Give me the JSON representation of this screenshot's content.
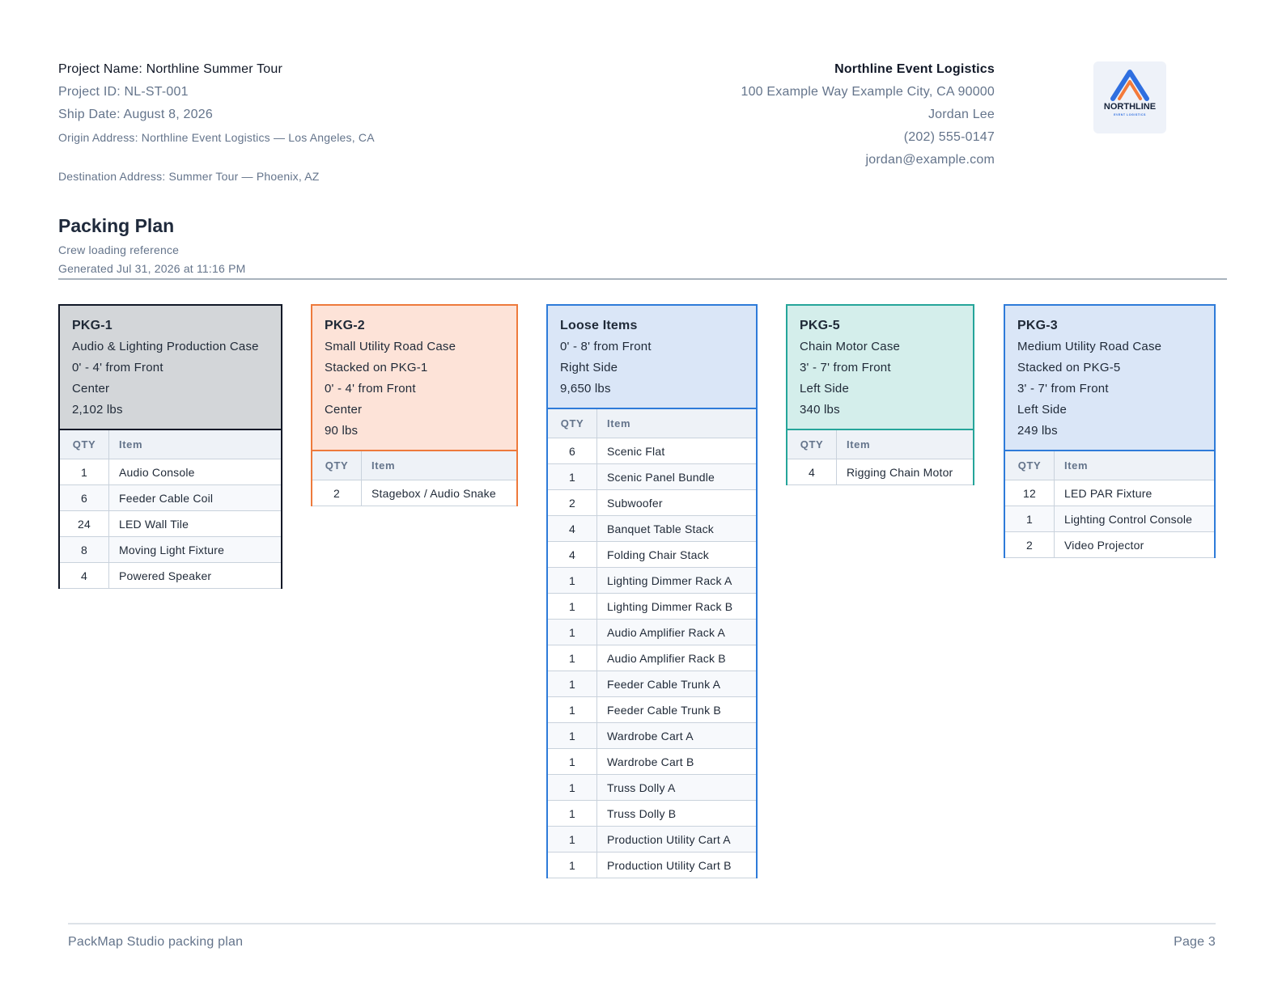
{
  "header": {
    "project_name": "Project Name: Northline Summer Tour",
    "project_id": "Project ID: NL-ST-001",
    "ship_date": "Ship Date: August 8, 2026",
    "origin": "Origin Address: Northline Event Logistics — Los Angeles, CA",
    "destination": "Destination Address: Summer Tour — Phoenix, AZ"
  },
  "company": {
    "name": "Northline Event Logistics",
    "address": "100 Example Way Example City, CA 90000",
    "contact": "Jordan Lee",
    "phone": "(202) 555-0147",
    "email": "jordan@example.com",
    "logo_text": "NORTHLINE",
    "logo_subtext": "EVENT LOGISTICS",
    "logo_colors": {
      "blue": "#2f6fe0",
      "orange": "#f47a3a",
      "text": "#16233a"
    }
  },
  "plan": {
    "title": "Packing Plan",
    "subtitle": "Crew loading reference",
    "generated": "Generated Jul 31, 2026 at 11:16 PM"
  },
  "table_headers": {
    "qty": "QTY",
    "item": "Item"
  },
  "packages": [
    {
      "name": "PKG-1",
      "color": {
        "border": "#111827",
        "fill": "#d3d6d9"
      },
      "details": [
        "Audio & Lighting Production Case",
        "0' - 4' from Front",
        "Center",
        "2,102 lbs"
      ],
      "items": [
        {
          "qty": "1",
          "item": "Audio Console"
        },
        {
          "qty": "6",
          "item": "Feeder Cable Coil"
        },
        {
          "qty": "24",
          "item": "LED Wall Tile"
        },
        {
          "qty": "8",
          "item": "Moving Light Fixture"
        },
        {
          "qty": "4",
          "item": "Powered Speaker"
        }
      ]
    },
    {
      "name": "PKG-2",
      "color": {
        "border": "#ee7a3c",
        "fill": "#fde3d8"
      },
      "details": [
        "Small Utility Road Case",
        "Stacked on PKG-1",
        "0' - 4' from Front",
        "Center",
        "90 lbs"
      ],
      "items": [
        {
          "qty": "2",
          "item": "Stagebox / Audio Snake"
        }
      ]
    },
    {
      "name": "Loose Items",
      "color": {
        "border": "#2e7bd9",
        "fill": "#dae6f7"
      },
      "details": [
        "0' - 8' from Front",
        "Right Side",
        "9,650 lbs"
      ],
      "items": [
        {
          "qty": "6",
          "item": "Scenic Flat"
        },
        {
          "qty": "1",
          "item": "Scenic Panel Bundle"
        },
        {
          "qty": "2",
          "item": "Subwoofer"
        },
        {
          "qty": "4",
          "item": "Banquet Table Stack"
        },
        {
          "qty": "4",
          "item": "Folding Chair Stack"
        },
        {
          "qty": "1",
          "item": "Lighting Dimmer Rack A"
        },
        {
          "qty": "1",
          "item": "Lighting Dimmer Rack B"
        },
        {
          "qty": "1",
          "item": "Audio Amplifier Rack A"
        },
        {
          "qty": "1",
          "item": "Audio Amplifier Rack B"
        },
        {
          "qty": "1",
          "item": "Feeder Cable Trunk A"
        },
        {
          "qty": "1",
          "item": "Feeder Cable Trunk B"
        },
        {
          "qty": "1",
          "item": "Wardrobe Cart A"
        },
        {
          "qty": "1",
          "item": "Wardrobe Cart B"
        },
        {
          "qty": "1",
          "item": "Truss Dolly A"
        },
        {
          "qty": "1",
          "item": "Truss Dolly B"
        },
        {
          "qty": "1",
          "item": "Production Utility Cart A"
        },
        {
          "qty": "1",
          "item": "Production Utility Cart B"
        }
      ]
    },
    {
      "name": "PKG-5",
      "color": {
        "border": "#25a59a",
        "fill": "#d4eeeb"
      },
      "details": [
        "Chain Motor Case",
        "3' - 7' from Front",
        "Left Side",
        "340 lbs"
      ],
      "items": [
        {
          "qty": "4",
          "item": "Rigging Chain Motor"
        }
      ]
    },
    {
      "name": "PKG-3",
      "color": {
        "border": "#2e7bd9",
        "fill": "#dae6f7"
      },
      "details": [
        "Medium Utility Road Case",
        "Stacked on PKG-5",
        "3' - 7' from Front",
        "Left Side",
        "249 lbs"
      ],
      "items": [
        {
          "qty": "12",
          "item": "LED PAR Fixture"
        },
        {
          "qty": "1",
          "item": "Lighting Control Console"
        },
        {
          "qty": "2",
          "item": "Video Projector"
        }
      ]
    }
  ],
  "footer": {
    "left": "PackMap Studio packing plan",
    "right": "Page 3"
  }
}
